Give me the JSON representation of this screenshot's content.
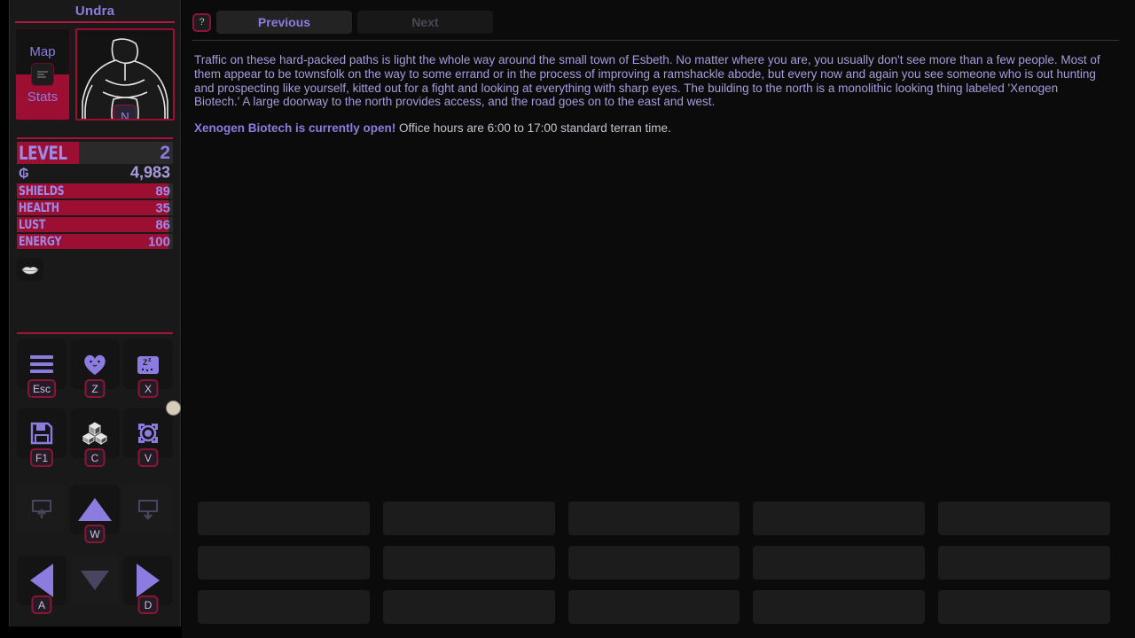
{
  "sidebar": {
    "character_name": "Undra",
    "tabs": [
      {
        "label": "Map",
        "active": false,
        "name": "map"
      },
      {
        "label": "Stats",
        "active": true,
        "name": "stats"
      }
    ],
    "tab_toggle_icon": "collapse-icon",
    "portrait": {
      "icon": "character-silhouette",
      "badge": "N"
    },
    "level": {
      "label": "LEVEL",
      "value": "2",
      "fill_percent": 40
    },
    "credits": {
      "icon": "credits-icon",
      "value": "4,983"
    },
    "bars": [
      {
        "label": "SHIELDS",
        "value": "89",
        "fill_percent": 97
      },
      {
        "label": "HEALTH",
        "value": "35",
        "fill_percent": 97
      },
      {
        "label": "LUST",
        "value": "86",
        "fill_percent": 97
      },
      {
        "label": "ENERGY",
        "value": "100",
        "fill_percent": 97
      }
    ],
    "status_effects": [
      {
        "icon": "lips-icon",
        "name": "lust-status"
      }
    ],
    "menu_buttons": [
      {
        "name": "menu",
        "icon": "hamburger-icon",
        "key": "Esc",
        "enabled": true,
        "notification": false
      },
      {
        "name": "appearance",
        "icon": "heart-icon",
        "key": "Z",
        "enabled": true,
        "notification": false
      },
      {
        "name": "rest",
        "icon": "sleep-icon",
        "key": "X",
        "enabled": true,
        "notification": false
      },
      {
        "name": "save",
        "icon": "floppy-icon",
        "key": "F1",
        "enabled": true,
        "notification": false
      },
      {
        "name": "inventory",
        "icon": "crates-icon",
        "key": "C",
        "enabled": true,
        "notification": false
      },
      {
        "name": "codex",
        "icon": "eye-target-icon",
        "key": "V",
        "enabled": true,
        "notification": true
      }
    ],
    "movement_buttons": [
      {
        "name": "exit-up",
        "icon": "exit-up-icon",
        "key": "",
        "enabled": false
      },
      {
        "name": "move-north",
        "icon": "arrow-up-icon",
        "key": "W",
        "enabled": true
      },
      {
        "name": "exit-down",
        "icon": "exit-down-icon",
        "key": "",
        "enabled": false
      },
      {
        "name": "move-west",
        "icon": "arrow-left-icon",
        "key": "A",
        "enabled": true
      },
      {
        "name": "move-south",
        "icon": "arrow-down-icon",
        "key": "",
        "enabled": false
      },
      {
        "name": "move-east",
        "icon": "arrow-right-icon",
        "key": "D",
        "enabled": true
      }
    ]
  },
  "main": {
    "help_button": "?",
    "nav": {
      "previous": "Previous",
      "next": "Next"
    },
    "story": {
      "paragraph": "Traffic on these hard-packed paths is light the whole way around the small town of Esbeth. No matter where you are, you usually don't see more than a few people. Most of them appear to be townsfolk on the way to some errand or in the process of improving a ramshackle abode, but every now and again you see someone who is out hunting and prospecting like yourself, kitted out for a fight and looking at everything with sharp eyes. The building to the north is a monolithic looking thing labeled 'Xenogen Biotech.' A large doorway to the north provides access, and the road goes on to the east and west.",
      "note_lead": "Xenogen Biotech is currently open!",
      "note_rest": " Office hours are 6:00 to 17:00 standard terran time."
    },
    "action_buttons": [
      "",
      "",
      "",
      "",
      "",
      "",
      "",
      "",
      "",
      "",
      "",
      "",
      "",
      "",
      ""
    ]
  },
  "colors": {
    "accent_crimson": "#9c0f33",
    "accent_purple": "#8d7ce0",
    "text_purple": "#a99bdc",
    "background": "#0b0b0b",
    "panel": "#191919"
  }
}
